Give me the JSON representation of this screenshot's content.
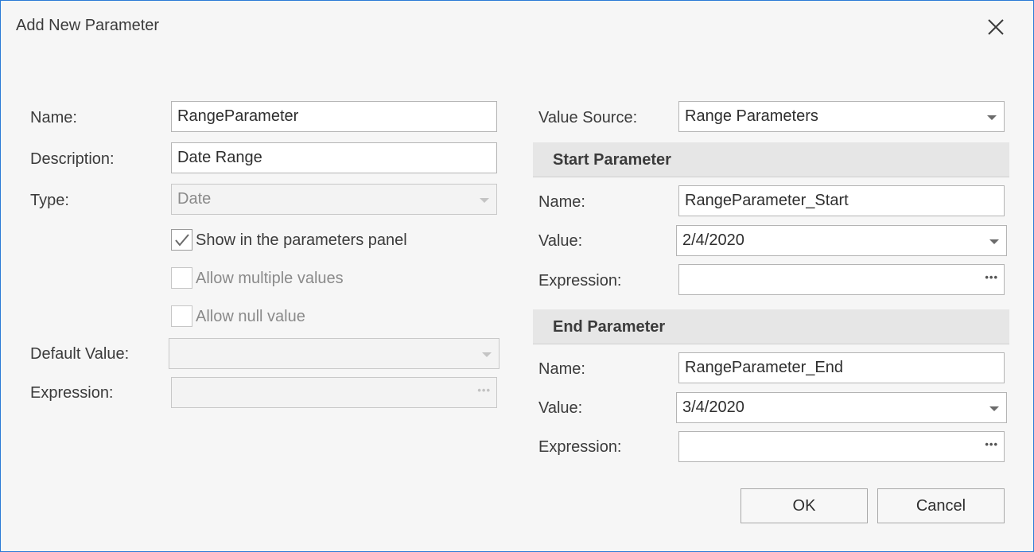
{
  "dialog": {
    "title": "Add New Parameter",
    "close_icon": "close-icon"
  },
  "left": {
    "name_label": "Name:",
    "name_value": "RangeParameter",
    "description_label": "Description:",
    "description_value": "Date Range",
    "type_label": "Type:",
    "type_value": "Date",
    "show_in_panel_label": "Show in the parameters panel",
    "show_in_panel_checked": true,
    "allow_multiple_label": "Allow multiple values",
    "allow_multiple_checked": false,
    "allow_null_label": "Allow null value",
    "allow_null_checked": false,
    "default_value_label": "Default Value:",
    "default_value": "",
    "expression_label": "Expression:",
    "expression_value": ""
  },
  "right": {
    "value_source_label": "Value Source:",
    "value_source_value": "Range Parameters",
    "start": {
      "heading": "Start Parameter",
      "name_label": "Name:",
      "name_value": "RangeParameter_Start",
      "value_label": "Value:",
      "value": "2/4/2020",
      "expression_label": "Expression:",
      "expression_value": ""
    },
    "end": {
      "heading": "End Parameter",
      "name_label": "Name:",
      "name_value": "RangeParameter_End",
      "value_label": "Value:",
      "value": "3/4/2020",
      "expression_label": "Expression:",
      "expression_value": ""
    }
  },
  "buttons": {
    "ok_label": "OK",
    "cancel_label": "Cancel"
  },
  "icons": {
    "ellipsis": "ellipsis-icon",
    "dropdown": "chevron-down-icon",
    "check": "checkmark-icon"
  },
  "colors": {
    "window_border": "#2b7bd6",
    "background": "#f6f6f6",
    "section_header": "#e6e6e6"
  }
}
